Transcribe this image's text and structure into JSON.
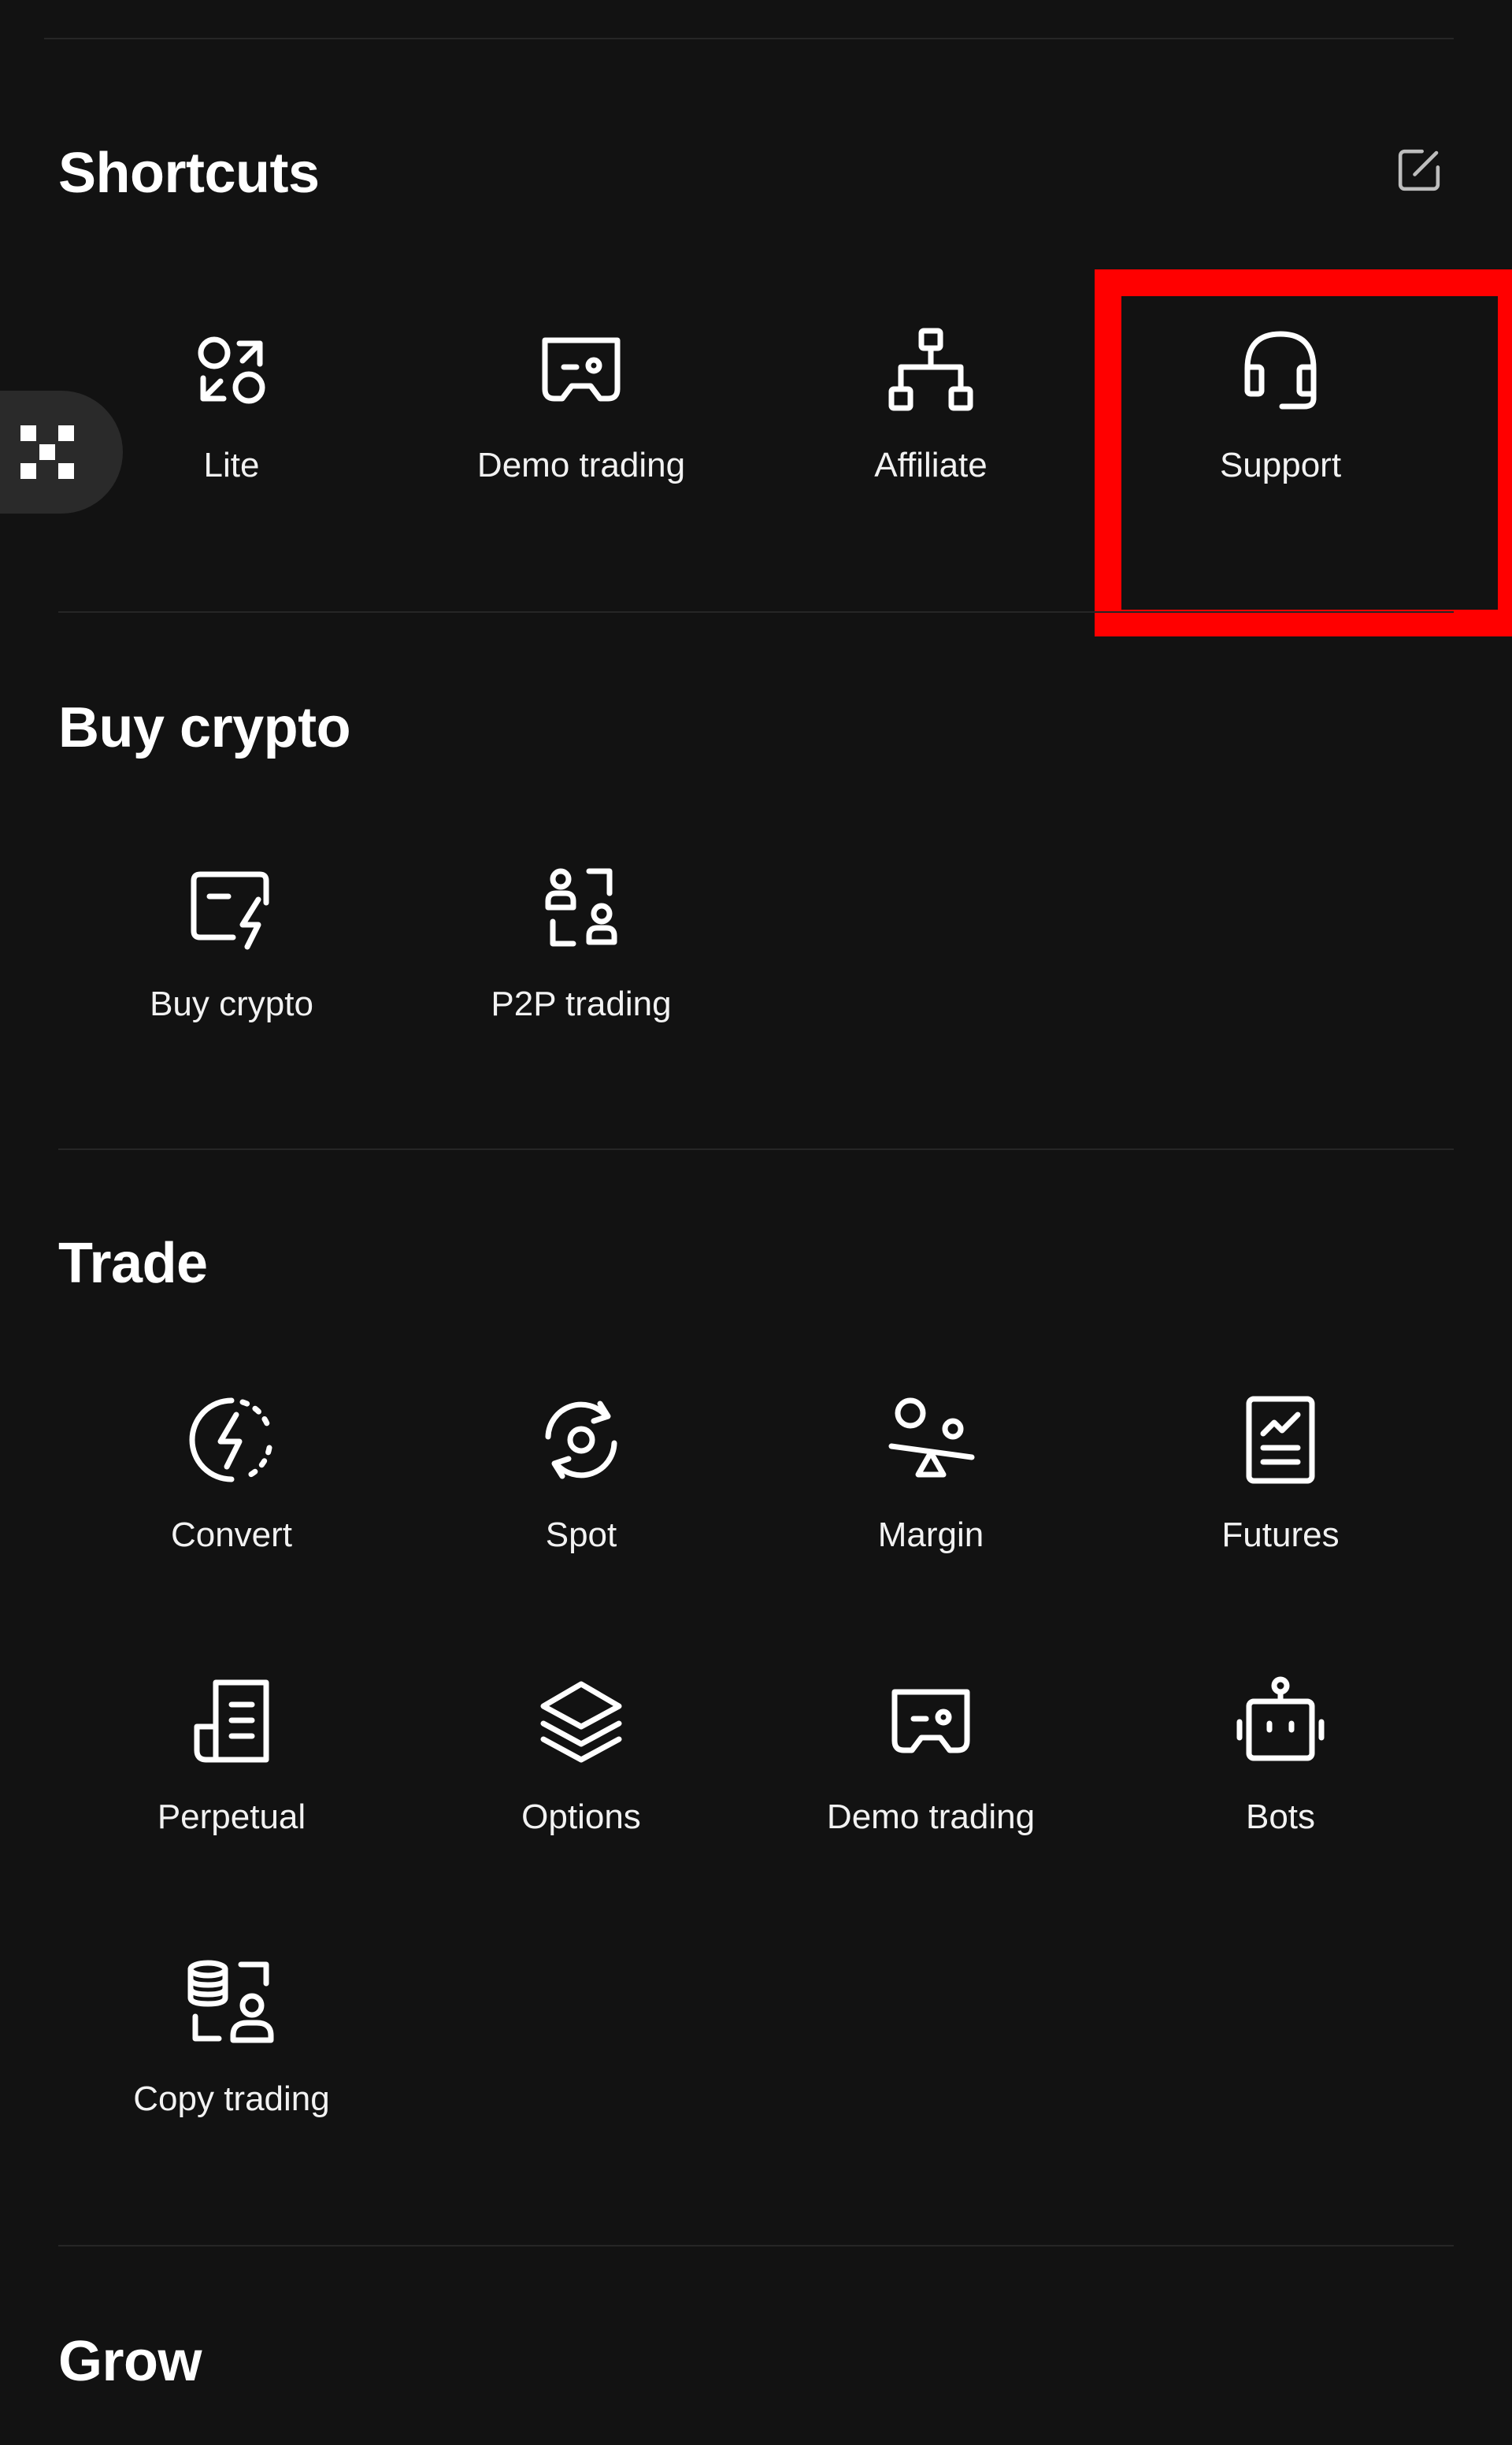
{
  "shortcuts": {
    "title": "Shortcuts",
    "edit_icon": "edit-square-icon",
    "items": [
      {
        "label": "Lite",
        "icon": "swap-circles-icon"
      },
      {
        "label": "Demo trading",
        "icon": "gamepad-icon"
      },
      {
        "label": "Affiliate",
        "icon": "org-chart-icon"
      },
      {
        "label": "Support",
        "icon": "headset-icon"
      }
    ]
  },
  "buy_crypto": {
    "title": "Buy crypto",
    "items": [
      {
        "label": "Buy crypto",
        "icon": "card-lightning-icon"
      },
      {
        "label": "P2P trading",
        "icon": "p2p-users-icon"
      }
    ]
  },
  "trade": {
    "title": "Trade",
    "items": [
      {
        "label": "Convert",
        "icon": "convert-bolt-icon"
      },
      {
        "label": "Spot",
        "icon": "spot-refresh-icon"
      },
      {
        "label": "Margin",
        "icon": "margin-balance-icon"
      },
      {
        "label": "Futures",
        "icon": "futures-document-icon"
      },
      {
        "label": "Perpetual",
        "icon": "perpetual-scroll-icon"
      },
      {
        "label": "Options",
        "icon": "layers-icon"
      },
      {
        "label": "Demo trading",
        "icon": "gamepad-icon"
      },
      {
        "label": "Bots",
        "icon": "robot-icon"
      },
      {
        "label": "Copy trading",
        "icon": "copy-trading-icon"
      }
    ]
  },
  "grow": {
    "title": "Grow"
  },
  "floating_button": {
    "icon": "okx-logo-icon"
  },
  "colors": {
    "background": "#121212",
    "divider": "#262626",
    "highlight": "#ff0000",
    "floating_tab": "#2a2a2a"
  }
}
